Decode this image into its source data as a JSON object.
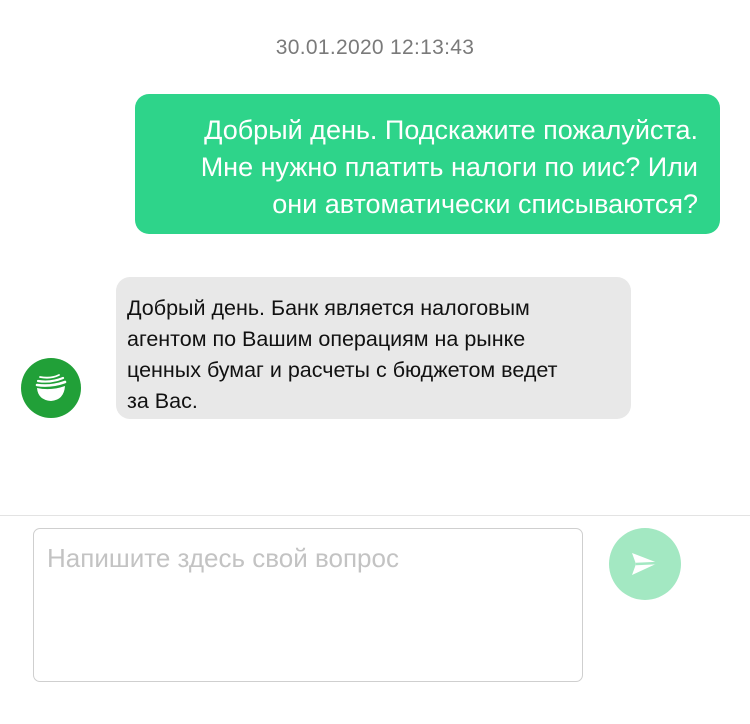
{
  "chat": {
    "timestamp": "30.01.2020 12:13:43",
    "messages": [
      {
        "sender": "user",
        "lines": [
          "Добрый день. Подскажите пожалуйста.",
          "Мне нужно платить налоги по иис? Или",
          "они автоматически списываются?"
        ]
      },
      {
        "sender": "bank",
        "lines": [
          "Добрый день. Банк является налоговым",
          "агентом по Вашим операциям на рынке",
          "ценных бумаг и расчеты с бюджетом ведет",
          "за Вас."
        ]
      }
    ]
  },
  "composer": {
    "placeholder": "Напишите здесь свой вопрос",
    "send_icon": "paper-plane-icon"
  },
  "avatar_icon": "sber-logo-icon",
  "colors": {
    "user_bubble": "#2ed48a",
    "bank_bubble": "#e8e8e8",
    "avatar": "#21a038",
    "send_button": "#a3e8c2"
  }
}
